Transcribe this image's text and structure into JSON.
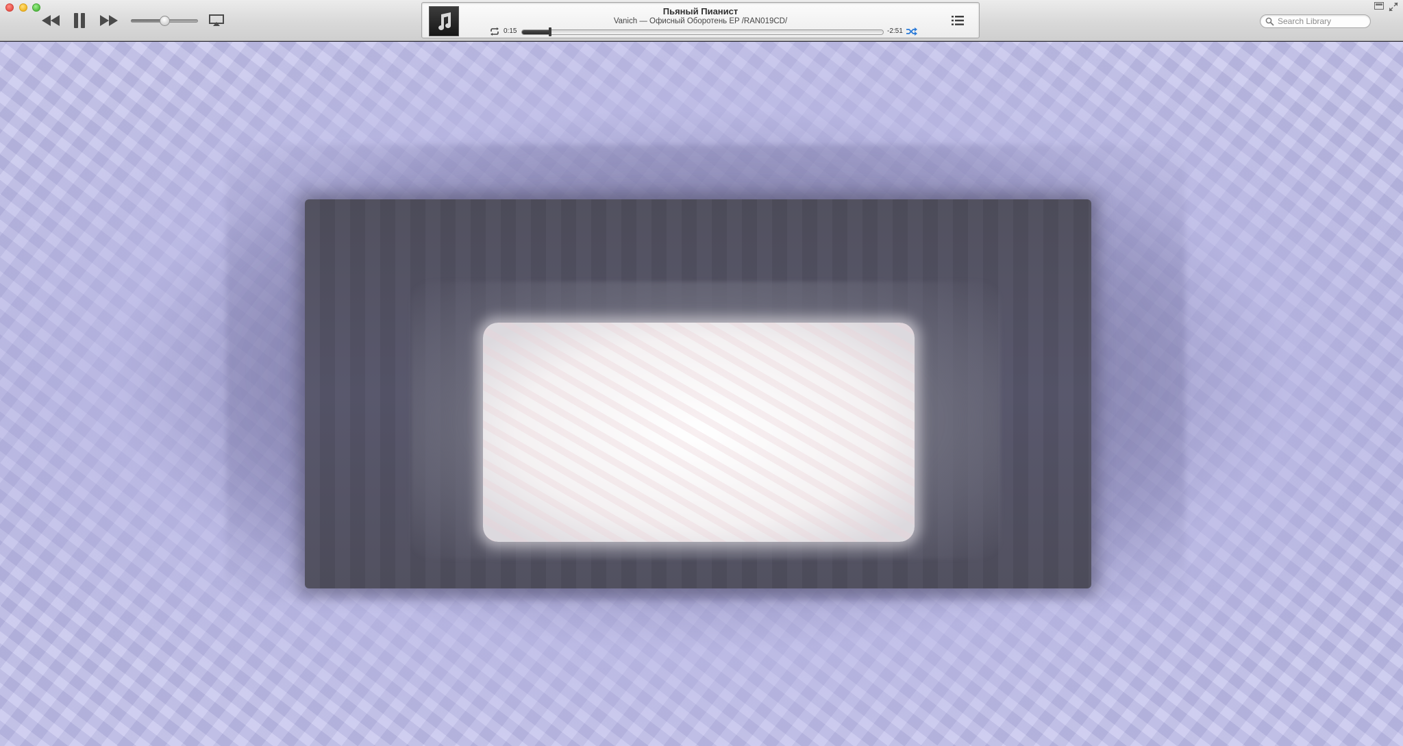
{
  "toolbar": {
    "now_playing": {
      "title": "Пьяный Пианист",
      "subtitle": "Vanich — Офисный Оборотень EP  /RAN019CD/",
      "elapsed": "0:15",
      "remaining": "-2:51",
      "progress_fraction": 0.08
    },
    "volume_fraction": 0.5,
    "search": {
      "placeholder": "Search Library",
      "value": ""
    }
  },
  "icons": {
    "prev": "rewind-icon",
    "pause": "pause-icon",
    "next": "fast-forward-icon",
    "airplay": "airplay-icon",
    "artwork": "music-note-icon",
    "repeat": "repeat-icon",
    "shuffle": "shuffle-icon",
    "up_next": "list-icon",
    "search": "search-icon",
    "miniplayer": "miniplayer-icon",
    "fullscreen": "fullscreen-icon"
  },
  "colors": {
    "shuffle_active": "#2b7bd8",
    "visualizer_light": "#c8c6ea",
    "visualizer_dark": "#4f4e5c"
  }
}
